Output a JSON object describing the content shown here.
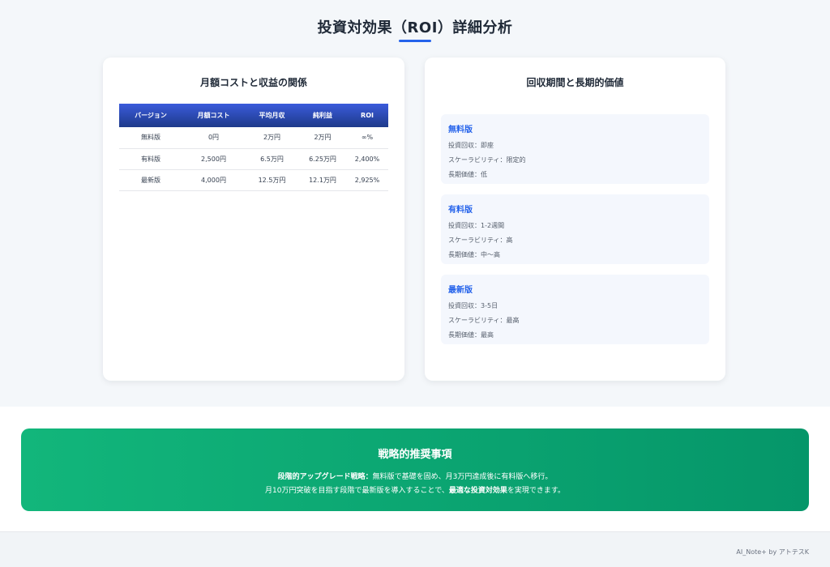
{
  "page": {
    "title": "投資対効果（ROI）詳細分析"
  },
  "cost_card": {
    "title": "月額コストと収益の関係",
    "columns": [
      "バージョン",
      "月額コスト",
      "平均月収",
      "純利益",
      "ROI"
    ],
    "rows": [
      [
        "無料版",
        "0円",
        "2万円",
        "2万円",
        "∞%"
      ],
      [
        "有料版",
        "2,500円",
        "6.5万円",
        "6.25万円",
        "2,400%"
      ],
      [
        "最新版",
        "4,000円",
        "12.5万円",
        "12.1万円",
        "2,925%"
      ]
    ]
  },
  "payback_card": {
    "title": "回収期間と長期的価値",
    "tiers": [
      {
        "name": "無料版",
        "lines": [
          "投資回収：即座",
          "スケーラビリティ：限定的",
          "長期価値：低"
        ]
      },
      {
        "name": "有料版",
        "lines": [
          "投資回収：1-2週間",
          "スケーラビリティ：高",
          "長期価値：中〜高"
        ]
      },
      {
        "name": "最新版",
        "lines": [
          "投資回収：3-5日",
          "スケーラビリティ：最高",
          "長期価値：最高"
        ]
      }
    ]
  },
  "recommendation": {
    "title": "戦略的推奨事項",
    "line1_bold": "段階的アップグレード戦略：",
    "line1_rest": "無料版で基礎を固め、月3万円達成後に有料版へ移行。",
    "line2_start": "月10万円突破を目指す段階で最新版を導入することで、",
    "line2_bold": "最適な投資対効果",
    "line2_end": "を実現できます。"
  },
  "footer": {
    "text": "AI_Note+ by アトテスK"
  },
  "colors": {
    "accent": "#2563eb",
    "table_header": "#2746c7",
    "recommendation": "#10b47a"
  }
}
